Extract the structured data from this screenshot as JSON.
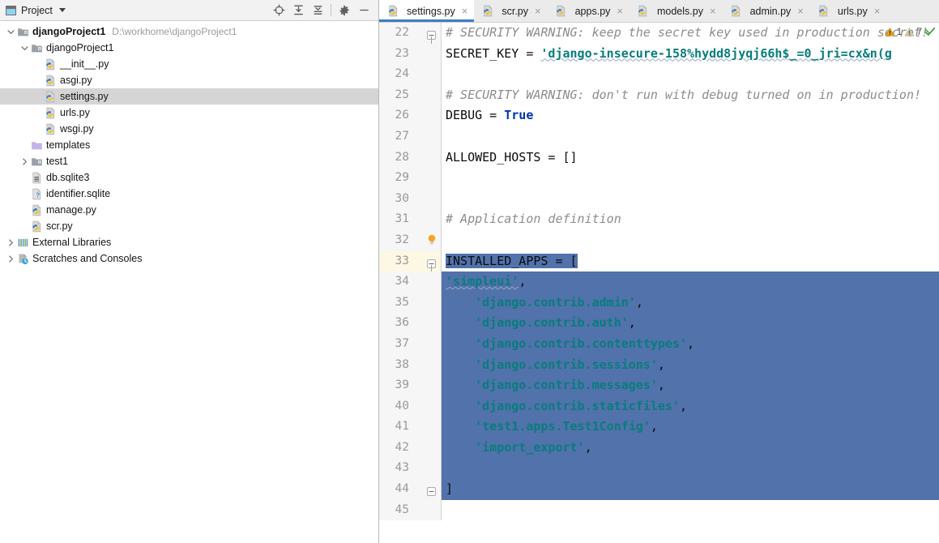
{
  "colors": {
    "accent_tab_underline": "#3d7fc1",
    "selection_bg": "#5272ab",
    "selection_fg": "#ffffff",
    "tree_selected_bg": "#d5d5d5",
    "current_line_bg": "#fdf8e3",
    "gutter_bg": "#f6f6f6",
    "comment": "#8c8c8c",
    "string": "#077d7d",
    "keyword": "#0033b3",
    "warning_yellow": "#e8a317",
    "warning_tan": "#c5bda0",
    "ok_green": "#3aa03a"
  },
  "project_panel": {
    "title": "Project",
    "window_icon": "project-window-icon",
    "dropdown_icon": "chevron-down-icon",
    "tools": [
      {
        "name": "locate-in-tree-icon",
        "label": "Select Opened File"
      },
      {
        "name": "expand-all-icon",
        "label": "Expand All"
      },
      {
        "name": "collapse-all-icon",
        "label": "Collapse All"
      },
      {
        "name": "gear-icon",
        "label": "Options"
      },
      {
        "name": "minimize-icon",
        "label": "Hide"
      }
    ],
    "tree": [
      {
        "label": "djangoProject1",
        "path": "D:\\workhome\\djangoProject1",
        "indent": 0,
        "twisty": "expanded",
        "icon": "module-folder-icon",
        "bold": true,
        "selected": false
      },
      {
        "label": "djangoProject1",
        "path": "",
        "indent": 1,
        "twisty": "expanded",
        "icon": "module-folder-icon",
        "bold": false,
        "selected": false
      },
      {
        "label": "__init__.py",
        "path": "",
        "indent": 2,
        "twisty": "none",
        "icon": "python-file-icon",
        "bold": false,
        "selected": false
      },
      {
        "label": "asgi.py",
        "path": "",
        "indent": 2,
        "twisty": "none",
        "icon": "python-file-icon",
        "bold": false,
        "selected": false
      },
      {
        "label": "settings.py",
        "path": "",
        "indent": 2,
        "twisty": "none",
        "icon": "python-file-icon",
        "bold": false,
        "selected": true
      },
      {
        "label": "urls.py",
        "path": "",
        "indent": 2,
        "twisty": "none",
        "icon": "python-file-icon",
        "bold": false,
        "selected": false
      },
      {
        "label": "wsgi.py",
        "path": "",
        "indent": 2,
        "twisty": "none",
        "icon": "python-file-icon",
        "bold": false,
        "selected": false
      },
      {
        "label": "templates",
        "path": "",
        "indent": 1,
        "twisty": "none",
        "icon": "templates-folder-icon",
        "bold": false,
        "selected": false
      },
      {
        "label": "test1",
        "path": "",
        "indent": 1,
        "twisty": "collapsed",
        "icon": "module-folder-icon",
        "bold": false,
        "selected": false
      },
      {
        "label": "db.sqlite3",
        "path": "",
        "indent": 1,
        "twisty": "none",
        "icon": "db-file-icon",
        "bold": false,
        "selected": false
      },
      {
        "label": "identifier.sqlite",
        "path": "",
        "indent": 1,
        "twisty": "none",
        "icon": "unknown-file-icon",
        "bold": false,
        "selected": false
      },
      {
        "label": "manage.py",
        "path": "",
        "indent": 1,
        "twisty": "none",
        "icon": "python-file-icon",
        "bold": false,
        "selected": false
      },
      {
        "label": "scr.py",
        "path": "",
        "indent": 1,
        "twisty": "none",
        "icon": "python-file-icon",
        "bold": false,
        "selected": false
      },
      {
        "label": "External Libraries",
        "path": "",
        "indent": 0,
        "twisty": "collapsed",
        "icon": "libraries-icon",
        "bold": false,
        "selected": false
      },
      {
        "label": "Scratches and Consoles",
        "path": "",
        "indent": 0,
        "twisty": "collapsed",
        "icon": "scratches-icon",
        "bold": false,
        "selected": false
      }
    ]
  },
  "editor": {
    "tabs": [
      {
        "label": "settings.py",
        "icon": "python-file-icon",
        "active": true,
        "close_icon": "close-icon"
      },
      {
        "label": "scr.py",
        "icon": "python-file-icon",
        "active": false,
        "close_icon": "close-icon"
      },
      {
        "label": "apps.py",
        "icon": "python-file-icon",
        "active": false,
        "close_icon": "close-icon"
      },
      {
        "label": "models.py",
        "icon": "python-file-icon",
        "active": false,
        "close_icon": "close-icon"
      },
      {
        "label": "admin.py",
        "icon": "python-file-icon",
        "active": false,
        "close_icon": "close-icon"
      },
      {
        "label": "urls.py",
        "icon": "python-file-icon",
        "active": false,
        "close_icon": "close-icon"
      }
    ],
    "inspections": {
      "warning_icon": "warning-triangle-icon",
      "warning_count": "1",
      "weak_warning_icon": "weak-warning-triangle-icon",
      "weak_warning_count": "7",
      "ok_icon": "inspection-ok-icon"
    },
    "current_line": 33,
    "lines": [
      {
        "num": "22",
        "fold": "start",
        "bulb": false,
        "selected": false,
        "tokens": [
          {
            "t": "# SECURITY WARNING: keep the secret key used in production secret!",
            "c": "comment"
          }
        ]
      },
      {
        "num": "23",
        "fold": "none",
        "bulb": false,
        "selected": false,
        "tokens": [
          {
            "t": "SECRET_KEY = ",
            "c": "plain"
          },
          {
            "t": "'django-insecure-158%hydd8jyqj66h$_=0_jri=cx&n(g",
            "c": "string squiggle"
          }
        ]
      },
      {
        "num": "24",
        "fold": "none",
        "bulb": false,
        "selected": false,
        "tokens": []
      },
      {
        "num": "25",
        "fold": "none",
        "bulb": false,
        "selected": false,
        "tokens": [
          {
            "t": "# SECURITY WARNING: don't run with debug turned on in production!",
            "c": "comment"
          }
        ]
      },
      {
        "num": "26",
        "fold": "none",
        "bulb": false,
        "selected": false,
        "tokens": [
          {
            "t": "DEBUG = ",
            "c": "plain"
          },
          {
            "t": "True",
            "c": "kw"
          }
        ]
      },
      {
        "num": "27",
        "fold": "none",
        "bulb": false,
        "selected": false,
        "tokens": []
      },
      {
        "num": "28",
        "fold": "none",
        "bulb": false,
        "selected": false,
        "tokens": [
          {
            "t": "ALLOWED_HOSTS = []",
            "c": "plain"
          }
        ]
      },
      {
        "num": "29",
        "fold": "none",
        "bulb": false,
        "selected": false,
        "tokens": []
      },
      {
        "num": "30",
        "fold": "none",
        "bulb": false,
        "selected": false,
        "tokens": []
      },
      {
        "num": "31",
        "fold": "none",
        "bulb": false,
        "selected": false,
        "tokens": [
          {
            "t": "# Application definition",
            "c": "comment"
          }
        ]
      },
      {
        "num": "32",
        "fold": "none",
        "bulb": true,
        "selected": false,
        "tokens": []
      },
      {
        "num": "33",
        "fold": "start",
        "bulb": false,
        "selected": true,
        "tokens": [
          {
            "t": "INSTALLED_APPS = [",
            "c": "plain"
          }
        ]
      },
      {
        "num": "34",
        "fold": "none",
        "bulb": false,
        "selected": true,
        "tokens": [
          {
            "t": "'simpleui'",
            "c": "string squiggle"
          },
          {
            "t": ",",
            "c": "plain"
          }
        ]
      },
      {
        "num": "35",
        "fold": "none",
        "bulb": false,
        "selected": true,
        "tokens": [
          {
            "t": "    ",
            "c": "plain"
          },
          {
            "t": "'django.contrib.admin'",
            "c": "string"
          },
          {
            "t": ",",
            "c": "plain"
          }
        ]
      },
      {
        "num": "36",
        "fold": "none",
        "bulb": false,
        "selected": true,
        "tokens": [
          {
            "t": "    ",
            "c": "plain"
          },
          {
            "t": "'django.contrib.auth'",
            "c": "string"
          },
          {
            "t": ",",
            "c": "plain"
          }
        ]
      },
      {
        "num": "37",
        "fold": "none",
        "bulb": false,
        "selected": true,
        "tokens": [
          {
            "t": "    ",
            "c": "plain"
          },
          {
            "t": "'django.contrib.contenttypes'",
            "c": "string"
          },
          {
            "t": ",",
            "c": "plain"
          }
        ]
      },
      {
        "num": "38",
        "fold": "none",
        "bulb": false,
        "selected": true,
        "tokens": [
          {
            "t": "    ",
            "c": "plain"
          },
          {
            "t": "'django.contrib.sessions'",
            "c": "string"
          },
          {
            "t": ",",
            "c": "plain"
          }
        ]
      },
      {
        "num": "39",
        "fold": "none",
        "bulb": false,
        "selected": true,
        "tokens": [
          {
            "t": "    ",
            "c": "plain"
          },
          {
            "t": "'django.contrib.messages'",
            "c": "string"
          },
          {
            "t": ",",
            "c": "plain"
          }
        ]
      },
      {
        "num": "40",
        "fold": "none",
        "bulb": false,
        "selected": true,
        "tokens": [
          {
            "t": "    ",
            "c": "plain"
          },
          {
            "t": "'django.contrib.staticfiles'",
            "c": "string"
          },
          {
            "t": ",",
            "c": "plain"
          }
        ]
      },
      {
        "num": "41",
        "fold": "none",
        "bulb": false,
        "selected": true,
        "tokens": [
          {
            "t": "    ",
            "c": "plain"
          },
          {
            "t": "'test1.apps.Test1Config'",
            "c": "string"
          },
          {
            "t": ",",
            "c": "plain"
          }
        ]
      },
      {
        "num": "42",
        "fold": "none",
        "bulb": false,
        "selected": true,
        "tokens": [
          {
            "t": "    ",
            "c": "plain"
          },
          {
            "t": "'import_export'",
            "c": "string"
          },
          {
            "t": ",",
            "c": "plain"
          }
        ]
      },
      {
        "num": "43",
        "fold": "none",
        "bulb": false,
        "selected": true,
        "tokens": []
      },
      {
        "num": "44",
        "fold": "end",
        "bulb": false,
        "selected": true,
        "tokens": [
          {
            "t": "]",
            "c": "plain"
          }
        ]
      },
      {
        "num": "45",
        "fold": "none",
        "bulb": false,
        "selected": false,
        "tokens": []
      }
    ]
  }
}
